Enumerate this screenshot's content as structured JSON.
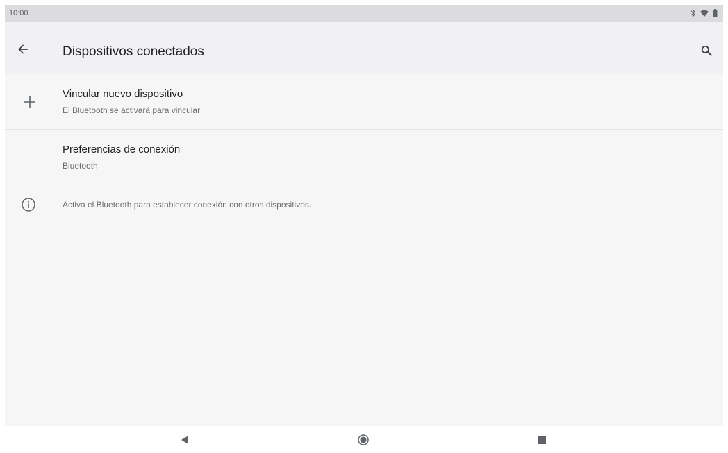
{
  "status_bar": {
    "time": "10:00",
    "icons": [
      "bluetooth-icon",
      "wifi-icon",
      "battery-icon"
    ]
  },
  "app_bar": {
    "title": "Dispositivos conectados",
    "back_icon": "arrow-back-icon",
    "search_icon": "search-icon"
  },
  "list": {
    "items": [
      {
        "icon": "plus-icon",
        "title": "Vincular nuevo dispositivo",
        "summary": "El Bluetooth se activará para vincular"
      },
      {
        "icon": "",
        "title": "Preferencias de conexión",
        "summary": "Bluetooth"
      }
    ],
    "info": {
      "icon": "info-icon",
      "text": "Activa el Bluetooth para establecer conexión con otros dispositivos."
    }
  },
  "nav_bar": {
    "icons": [
      "back-triangle-icon",
      "home-circle-icon",
      "recents-square-icon"
    ]
  },
  "colors": {
    "background": "#f6f6f7",
    "status_bar": "#dcdcde",
    "app_bar": "#f1f1f3",
    "text_primary": "#202124",
    "text_secondary": "#6b6b70"
  }
}
